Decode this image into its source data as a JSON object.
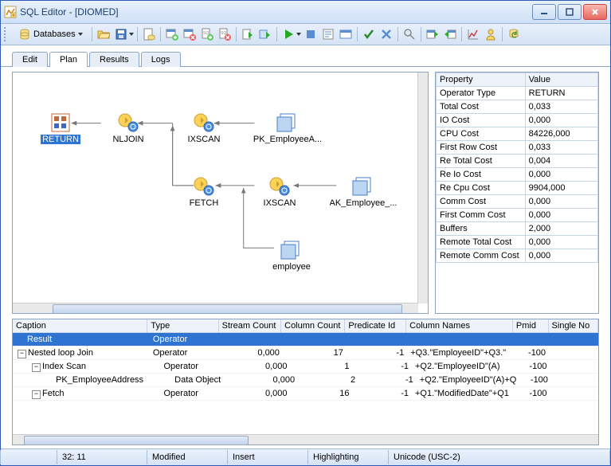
{
  "window": {
    "title": "SQL Editor - [DIOMED]"
  },
  "toolbar": {
    "databases_label": "Databases"
  },
  "tabs": {
    "edit": "Edit",
    "plan": "Plan",
    "results": "Results",
    "logs": "Logs"
  },
  "plan_nodes": {
    "return": "RETURN",
    "nljoin": "NLJOIN",
    "ixscan1": "IXSCAN",
    "pk_emp": "PK_EmployeeA...",
    "fetch": "FETCH",
    "ixscan2": "IXSCAN",
    "ak_emp": "AK_Employee_...",
    "employee": "employee"
  },
  "props": {
    "header_property": "Property",
    "header_value": "Value",
    "rows": [
      {
        "k": "Operator Type",
        "v": "RETURN"
      },
      {
        "k": "Total Cost",
        "v": "0,033"
      },
      {
        "k": "IO Cost",
        "v": "0,000"
      },
      {
        "k": "CPU Cost",
        "v": "84226,000"
      },
      {
        "k": "First Row Cost",
        "v": "0,033"
      },
      {
        "k": "Re Total Cost",
        "v": "0,004"
      },
      {
        "k": "Re Io Cost",
        "v": "0,000"
      },
      {
        "k": "Re Cpu Cost",
        "v": "9904,000"
      },
      {
        "k": "Comm Cost",
        "v": "0,000"
      },
      {
        "k": "First Comm Cost",
        "v": "0,000"
      },
      {
        "k": "Buffers",
        "v": "2,000"
      },
      {
        "k": "Remote Total Cost",
        "v": "0,000"
      },
      {
        "k": "Remote Comm Cost",
        "v": "0,000"
      }
    ]
  },
  "grid": {
    "headers": [
      "Caption",
      "Type",
      "Stream Count",
      "Column Count",
      "Predicate Id",
      "Column Names",
      "Pmid",
      "Single No"
    ],
    "rows": [
      {
        "indent": 0,
        "toggle": "",
        "caption": "Result",
        "type": "Operator",
        "stream": "",
        "col": "",
        "pred": "",
        "names": "",
        "pmid": "",
        "sel": true
      },
      {
        "indent": 0,
        "toggle": "-",
        "caption": "Nested loop Join",
        "type": "Operator",
        "stream": "0,000",
        "col": "17",
        "pred": "-1",
        "names": "+Q3.\"EmployeeID\"+Q3.\"",
        "pmid": "-100",
        "sel": false
      },
      {
        "indent": 1,
        "toggle": "-",
        "caption": "Index Scan",
        "type": "Operator",
        "stream": "0,000",
        "col": "1",
        "pred": "-1",
        "names": "+Q2.\"EmployeeID\"(A)",
        "pmid": "-100",
        "sel": false
      },
      {
        "indent": 2,
        "toggle": "",
        "caption": "PK_EmployeeAddress",
        "type": "Data Object",
        "stream": "0,000",
        "col": "2",
        "pred": "-1",
        "names": "+Q2.\"EmployeeID\"(A)+Q",
        "pmid": "-100",
        "sel": false
      },
      {
        "indent": 1,
        "toggle": "-",
        "caption": "Fetch",
        "type": "Operator",
        "stream": "0,000",
        "col": "16",
        "pred": "-1",
        "names": "+Q1.\"ModifiedDate\"+Q1",
        "pmid": "-100",
        "sel": false
      }
    ]
  },
  "status": {
    "pos": "32:  11",
    "modified": "Modified",
    "insert": "Insert",
    "highlighting": "Highlighting",
    "encoding": "Unicode (USC-2)"
  }
}
